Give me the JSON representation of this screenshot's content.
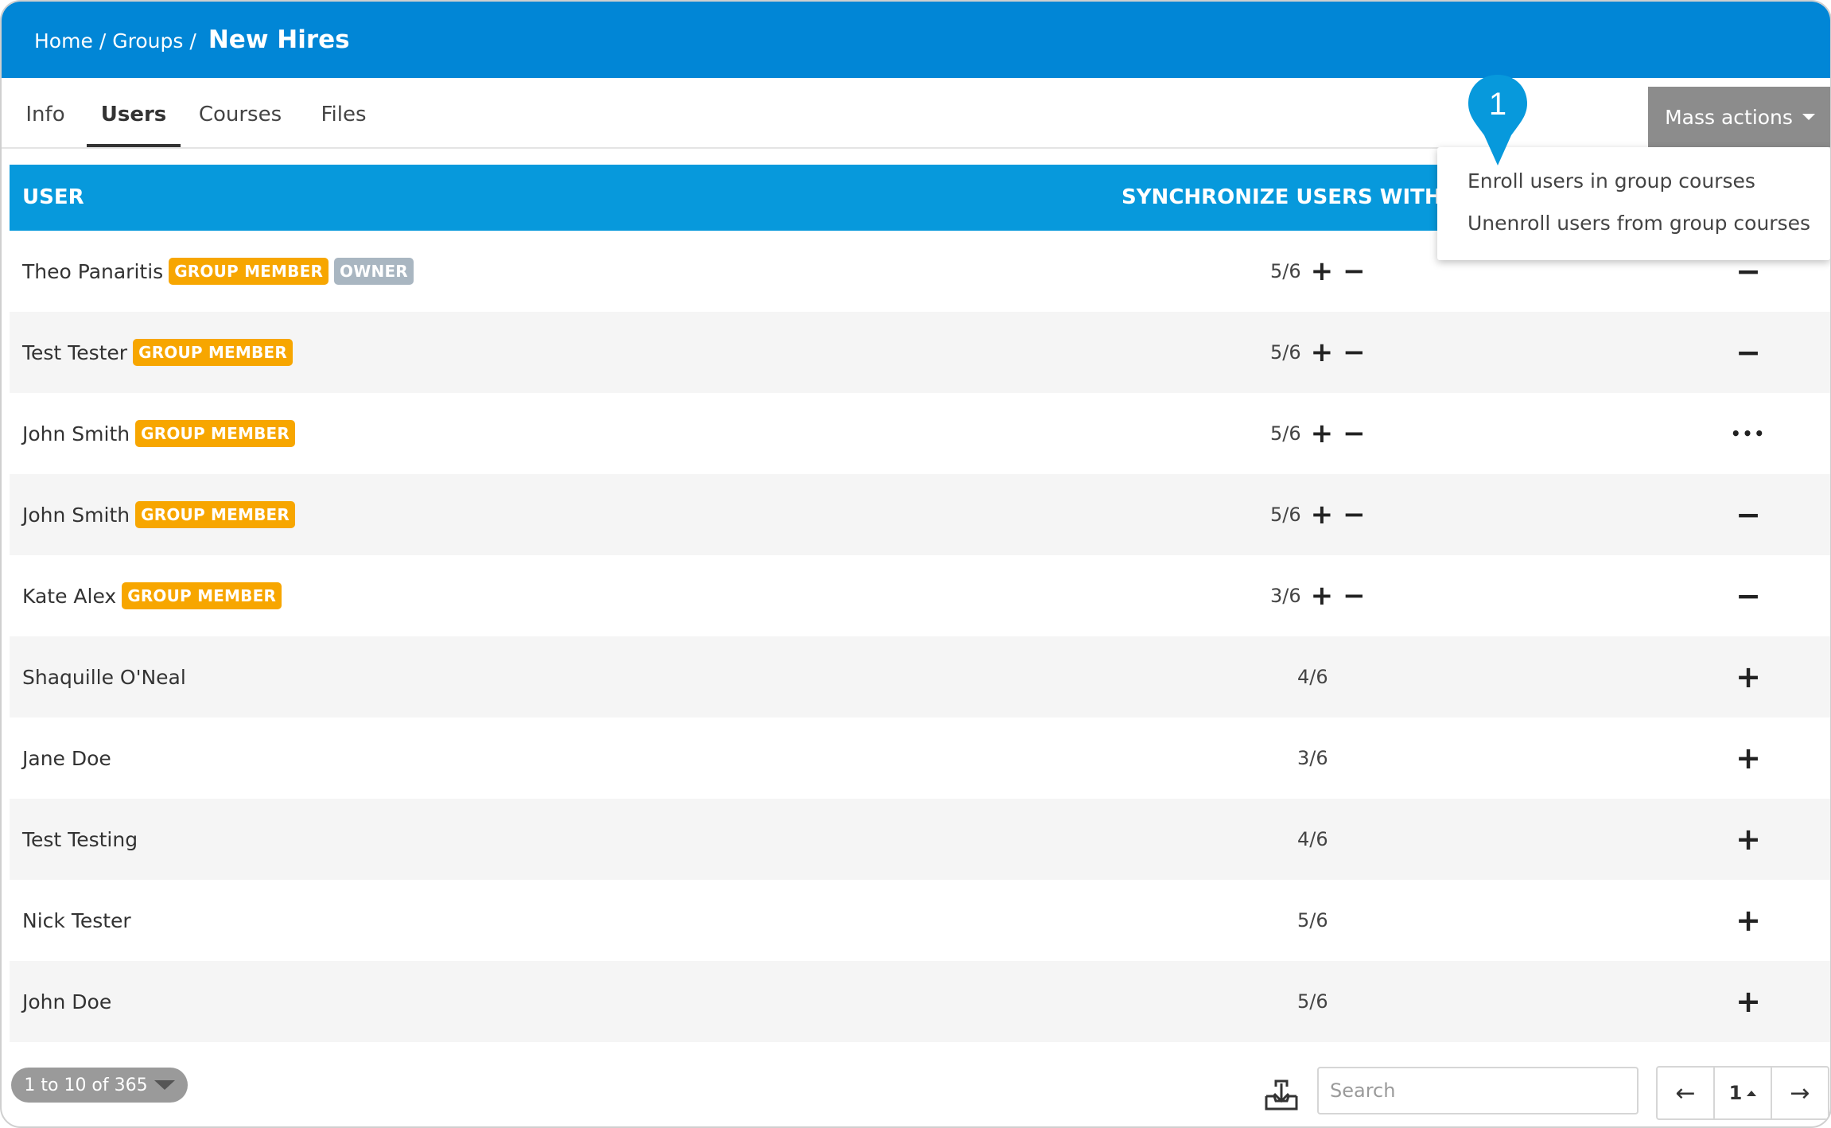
{
  "breadcrumb": {
    "home": "Home",
    "separator": "/",
    "groups": "Groups",
    "current": "New Hires"
  },
  "tabs": [
    {
      "label": "Info",
      "active": false
    },
    {
      "label": "Users",
      "active": true
    },
    {
      "label": "Courses",
      "active": false
    },
    {
      "label": "Files",
      "active": false
    }
  ],
  "mass_actions": {
    "label": "Mass actions",
    "menu": [
      "Enroll users in group courses",
      "Unenroll users from group courses"
    ]
  },
  "callout": {
    "number": "1",
    "color": "#0799dc"
  },
  "table": {
    "columns": {
      "user": "USER",
      "sync": "SYNCHRONIZE USERS WITH CO"
    },
    "rows": [
      {
        "name": "Theo Panaritis",
        "badges": [
          "GROUP MEMBER",
          "OWNER"
        ],
        "sync": "5/6",
        "sync_controls": true,
        "action": "minus"
      },
      {
        "name": "Test Tester",
        "badges": [
          "GROUP MEMBER"
        ],
        "sync": "5/6",
        "sync_controls": true,
        "action": "minus"
      },
      {
        "name": "John Smith",
        "badges": [
          "GROUP MEMBER"
        ],
        "sync": "5/6",
        "sync_controls": true,
        "action": "more"
      },
      {
        "name": "John Smith",
        "badges": [
          "GROUP MEMBER"
        ],
        "sync": "5/6",
        "sync_controls": true,
        "action": "minus"
      },
      {
        "name": "Kate Alex",
        "badges": [
          "GROUP MEMBER"
        ],
        "sync": "3/6",
        "sync_controls": true,
        "action": "minus"
      },
      {
        "name": "Shaquille O'Neal",
        "badges": [],
        "sync": "4/6",
        "sync_controls": false,
        "action": "plus"
      },
      {
        "name": "Jane Doe",
        "badges": [],
        "sync": "3/6",
        "sync_controls": false,
        "action": "plus"
      },
      {
        "name": "Test Testing",
        "badges": [],
        "sync": "4/6",
        "sync_controls": false,
        "action": "plus"
      },
      {
        "name": "Nick Tester",
        "badges": [],
        "sync": "5/6",
        "sync_controls": false,
        "action": "plus"
      },
      {
        "name": "John Doe",
        "badges": [],
        "sync": "5/6",
        "sync_controls": false,
        "action": "plus"
      }
    ]
  },
  "footer": {
    "range": "1 to 10 of 365",
    "search_placeholder": "Search",
    "page": "1",
    "prev": "←",
    "next": "→"
  },
  "colors": {
    "header": "#0186d6",
    "table_header": "#0799dc",
    "member_badge": "#f7a600",
    "owner_badge": "#a9b6c1"
  }
}
